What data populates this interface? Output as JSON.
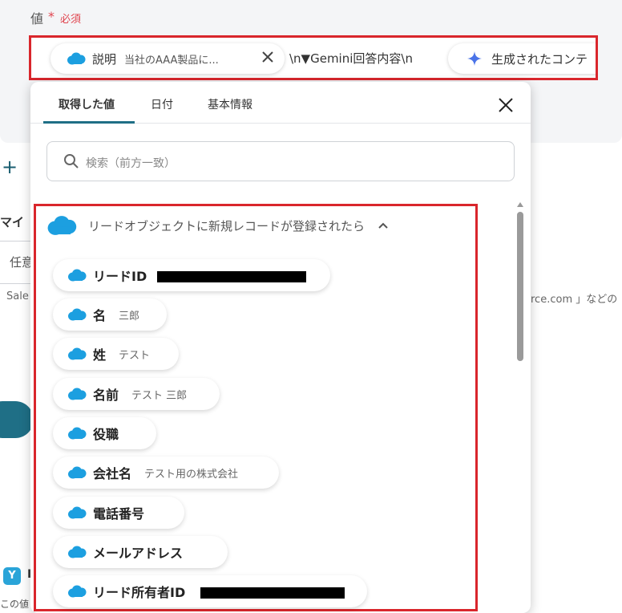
{
  "form": {
    "field_label": "値",
    "required_star": "*",
    "required_text": "必須",
    "chip_desc_key": "説明",
    "chip_desc_value": "当社のAAA製品に...",
    "between_text": "\\n▼Gemini回答内容\\n",
    "chip_gen_key": "生成されたコンテ"
  },
  "background": {
    "add_icon": "+",
    "fragment_my": "マイ",
    "fragment_input": "任意",
    "fragment_sale": "Sale",
    "fragment_right": "rce.com 」などの",
    "fragment_badge": "Y",
    "fragment_badge_text": "I",
    "fragment_bottom": "この値"
  },
  "popover": {
    "tabs": [
      {
        "label": "取得した値"
      },
      {
        "label": "日付"
      },
      {
        "label": "基本情報"
      }
    ],
    "search_placeholder": "検索（前方一致）",
    "group_title": "リードオブジェクトに新規レコードが登録されたら",
    "items": [
      {
        "key": "リードID",
        "value": ""
      },
      {
        "key": "名",
        "value": "三郎"
      },
      {
        "key": "姓",
        "value": "テスト"
      },
      {
        "key": "名前",
        "value": "テスト 三郎"
      },
      {
        "key": "役職",
        "value": ""
      },
      {
        "key": "会社名",
        "value": "テスト用の株式会社"
      },
      {
        "key": "電話番号",
        "value": ""
      },
      {
        "key": "メールアドレス",
        "value": ""
      },
      {
        "key": "リード所有者ID",
        "value": ""
      }
    ]
  },
  "icons": {
    "salesforce": "salesforce-cloud-icon",
    "gemini": "sparkle-icon",
    "close": "close-icon",
    "search": "search-icon",
    "collapse": "chevron-up-icon"
  },
  "colors": {
    "highlight_red": "#d9262c",
    "salesforce_blue": "#1c9fe0",
    "accent_teal": "#1f6f86",
    "required_red": "#e0454f"
  }
}
